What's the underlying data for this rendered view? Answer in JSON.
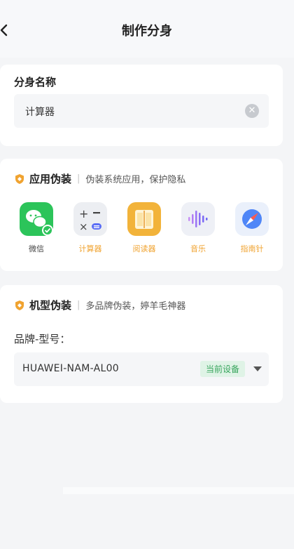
{
  "header": {
    "title": "制作分身"
  },
  "name_section": {
    "title": "分身名称",
    "input_value": "计算器"
  },
  "app_disguise": {
    "title": "应用伪装",
    "subtitle": "伪装系统应用，保护隐私",
    "apps": [
      {
        "label": "微信",
        "icon": "wechat-icon",
        "color": "#2cc45a"
      },
      {
        "label": "计算器",
        "icon": "calculator-icon",
        "color": "#f0a330"
      },
      {
        "label": "阅读器",
        "icon": "reader-icon",
        "color": "#f0a330"
      },
      {
        "label": "音乐",
        "icon": "music-icon",
        "color": "#f0a330"
      },
      {
        "label": "指南针",
        "icon": "compass-icon",
        "color": "#f0a330"
      }
    ]
  },
  "model_disguise": {
    "title": "机型伪装",
    "subtitle": "多品牌伪装，婷羊毛神器",
    "field_label": "品牌-型号：",
    "selected_model": "HUAWEI-NAM-AL00",
    "badge": "当前设备"
  },
  "colors": {
    "accent": "#f0a330",
    "badge_green": "#38a55d"
  }
}
